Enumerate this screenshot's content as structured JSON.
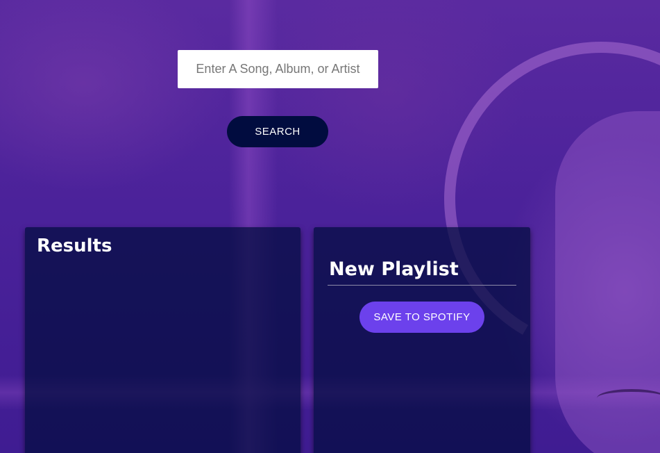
{
  "search": {
    "placeholder": "Enter A Song, Album, or Artist",
    "button_label": "SEARCH"
  },
  "results": {
    "title": "Results",
    "tracks": []
  },
  "playlist": {
    "name": "New Playlist",
    "save_label": "SAVE TO SPOTIFY",
    "tracks": []
  },
  "colors": {
    "background": "#4a2396",
    "panel": "#010c3f",
    "search_button": "#010c3f",
    "save_button": "#6c41ec",
    "text": "#ffffff"
  }
}
